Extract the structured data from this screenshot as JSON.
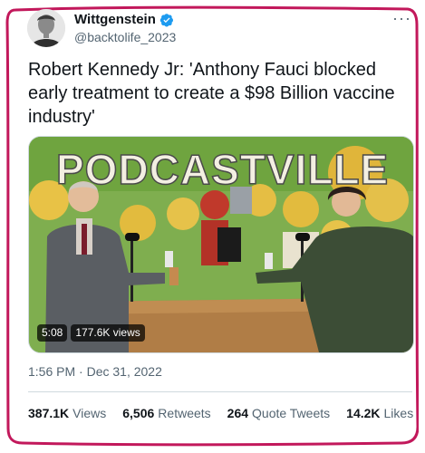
{
  "author": {
    "name": "Wittgenstein",
    "handle": "@backtolife_2023",
    "verified": true,
    "more_icon": "more-horizontal-icon"
  },
  "tweet": {
    "text": "Robert Kennedy Jr: 'Anthony Fauci blocked early treatment to create a $98 Billion vaccine industry'"
  },
  "media": {
    "banner_text": "PODCASTVILLE",
    "duration": "5:08",
    "views": "177.6K views"
  },
  "timestamp": "1:56 PM · Dec 31, 2022",
  "stats": [
    {
      "value": "387.1K",
      "label": "Views"
    },
    {
      "value": "6,506",
      "label": "Retweets"
    },
    {
      "value": "264",
      "label": "Quote Tweets"
    },
    {
      "value": "14.2K",
      "label": "Likes"
    }
  ],
  "colors": {
    "text": "#0f1419",
    "secondary": "#536471",
    "verified": "#1d9bf0",
    "frame": "#c2185b"
  }
}
